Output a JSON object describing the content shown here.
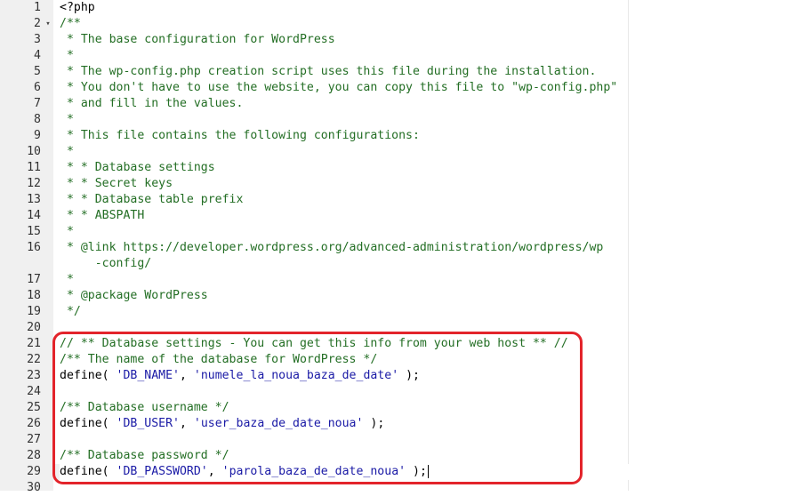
{
  "editor": {
    "language": "php",
    "active_line": 29,
    "fold_icon": "chevron-down-icon",
    "highlight_color": "#e3242b",
    "lines": [
      {
        "n": "1",
        "tokens": [
          {
            "t": "plain",
            "v": "<?php"
          }
        ]
      },
      {
        "n": "2",
        "fold": "▾",
        "tokens": [
          {
            "t": "comment",
            "v": "/**"
          }
        ]
      },
      {
        "n": "3",
        "tokens": [
          {
            "t": "comment",
            "v": " * The base configuration for WordPress"
          }
        ]
      },
      {
        "n": "4",
        "tokens": [
          {
            "t": "comment",
            "v": " *"
          }
        ]
      },
      {
        "n": "5",
        "tokens": [
          {
            "t": "comment",
            "v": " * The wp-config.php creation script uses this file during the installation."
          }
        ]
      },
      {
        "n": "6",
        "tokens": [
          {
            "t": "comment",
            "v": " * You don't have to use the website, you can copy this file to \"wp-config.php\""
          }
        ]
      },
      {
        "n": "7",
        "tokens": [
          {
            "t": "comment",
            "v": " * and fill in the values."
          }
        ]
      },
      {
        "n": "8",
        "tokens": [
          {
            "t": "comment",
            "v": " *"
          }
        ]
      },
      {
        "n": "9",
        "tokens": [
          {
            "t": "comment",
            "v": " * This file contains the following configurations:"
          }
        ]
      },
      {
        "n": "10",
        "tokens": [
          {
            "t": "comment",
            "v": " *"
          }
        ]
      },
      {
        "n": "11",
        "tokens": [
          {
            "t": "comment",
            "v": " * * Database settings"
          }
        ]
      },
      {
        "n": "12",
        "tokens": [
          {
            "t": "comment",
            "v": " * * Secret keys"
          }
        ]
      },
      {
        "n": "13",
        "tokens": [
          {
            "t": "comment",
            "v": " * * Database table prefix"
          }
        ]
      },
      {
        "n": "14",
        "tokens": [
          {
            "t": "comment",
            "v": " * * ABSPATH"
          }
        ]
      },
      {
        "n": "15",
        "tokens": [
          {
            "t": "comment",
            "v": " *"
          }
        ]
      },
      {
        "n": "16",
        "tokens": [
          {
            "t": "comment",
            "v": " * @link https://developer.wordpress.org/advanced-administration/wordpress/wp"
          }
        ]
      },
      {
        "n": "",
        "tokens": [
          {
            "t": "comment",
            "v": "     -config/"
          }
        ]
      },
      {
        "n": "17",
        "tokens": [
          {
            "t": "comment",
            "v": " *"
          }
        ]
      },
      {
        "n": "18",
        "tokens": [
          {
            "t": "comment",
            "v": " * @package WordPress"
          }
        ]
      },
      {
        "n": "19",
        "tokens": [
          {
            "t": "comment",
            "v": " */"
          }
        ]
      },
      {
        "n": "20",
        "tokens": []
      },
      {
        "n": "21",
        "tokens": [
          {
            "t": "comment",
            "v": "// ** Database settings - You can get this info from your web host ** //"
          }
        ]
      },
      {
        "n": "22",
        "tokens": [
          {
            "t": "comment",
            "v": "/** The name of the database for WordPress */"
          }
        ]
      },
      {
        "n": "23",
        "tokens": [
          {
            "t": "plain",
            "v": "define( "
          },
          {
            "t": "string",
            "v": "'DB_NAME'"
          },
          {
            "t": "plain",
            "v": ", "
          },
          {
            "t": "string",
            "v": "'numele_la_noua_baza_de_date'"
          },
          {
            "t": "plain",
            "v": " );"
          }
        ]
      },
      {
        "n": "24",
        "tokens": []
      },
      {
        "n": "25",
        "tokens": [
          {
            "t": "comment",
            "v": "/** Database username */"
          }
        ]
      },
      {
        "n": "26",
        "tokens": [
          {
            "t": "plain",
            "v": "define( "
          },
          {
            "t": "string",
            "v": "'DB_USER'"
          },
          {
            "t": "plain",
            "v": ", "
          },
          {
            "t": "string",
            "v": "'user_baza_de_date_noua'"
          },
          {
            "t": "plain",
            "v": " );"
          }
        ]
      },
      {
        "n": "27",
        "tokens": []
      },
      {
        "n": "28",
        "tokens": [
          {
            "t": "comment",
            "v": "/** Database password */"
          }
        ]
      },
      {
        "n": "29",
        "active": true,
        "cursor": true,
        "tokens": [
          {
            "t": "plain",
            "v": "define( "
          },
          {
            "t": "string",
            "v": "'DB_PASSWORD'"
          },
          {
            "t": "plain",
            "v": ", "
          },
          {
            "t": "string",
            "v": "'parola_baza_de_date_noua'"
          },
          {
            "t": "plain",
            "v": " );"
          }
        ]
      },
      {
        "n": "30",
        "tokens": []
      }
    ]
  }
}
